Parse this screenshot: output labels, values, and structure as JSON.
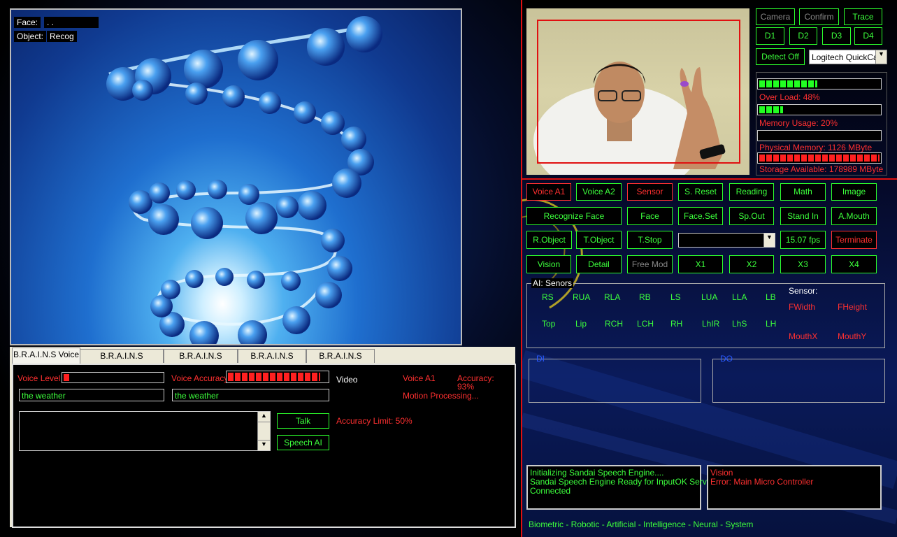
{
  "viewer": {
    "face_label": "Face:",
    "face_value": ".                  .",
    "object_label": "Object:",
    "object_value": "Recog"
  },
  "tabs": [
    {
      "label": "B.R.A.I.N.S Voice"
    },
    {
      "label": "B.R.A.I.N.S Movement"
    },
    {
      "label": "B.R.A.I.N.S Manual"
    },
    {
      "label": "B.R.A.I.N.S Vision"
    },
    {
      "label": "B.R.A.I.N.S Senor"
    }
  ],
  "voice": {
    "level_label": "Voice Level",
    "level_fraction": 0.06,
    "accuracy_label": "Voice Accuracy",
    "accuracy_fraction": 0.93,
    "field1_value": "the weather",
    "field2_value": "the weather",
    "video_label": "Video",
    "voice_a1_label": "Voice A1",
    "accuracy_text": "Accuracy:",
    "accuracy_value": "93%",
    "motion_text": "Motion Processing...",
    "talk_label": "Talk",
    "speech_ai_label": "Speech AI",
    "accuracy_limit": "Accuracy Limit: 50%"
  },
  "camera_controls": {
    "camera_label": "Camera",
    "confirm_label": "Confirm",
    "trace_label": "Trace",
    "d1": "D1",
    "d2": "D2",
    "d3": "D3",
    "d4": "D4",
    "detect_off": "Detect Off",
    "camera_select": "Logitech QuickCam"
  },
  "stats": {
    "overload_label": "Over Load: 48%",
    "overload_fraction": 0.48,
    "memory_label": "Memory Usage: 20%",
    "memory_fraction": 0.2,
    "physical_label": "Physical Memory: 1126 MByte",
    "physical_fraction": 0.0,
    "storage_label": "Storage Available: 178989 MByte",
    "storage_fraction": 1.0
  },
  "buttons": {
    "row1": [
      "Voice A1",
      "Voice A2",
      "Sensor",
      "S. Reset",
      "Reading",
      "Math",
      "Image"
    ],
    "row2": [
      "Recognize Face",
      "Face",
      "Face.Set",
      "Sp.Out",
      "Stand In",
      "A.Mouth"
    ],
    "row3": [
      "R.Object",
      "T.Object",
      "T.Stop",
      "15.07 fps",
      "Terminate"
    ],
    "row4": [
      "Vision",
      "Detail",
      "Free Mod",
      "X1",
      "X2",
      "X3",
      "X4"
    ]
  },
  "sensors": {
    "title": "AI: Senors",
    "row1": [
      "RS",
      "RUA",
      "RLA",
      "RB",
      "LS",
      "LUA",
      "LLA",
      "LB"
    ],
    "row2": [
      "Top",
      "Lip",
      "RCH",
      "LCH",
      "RH",
      "LhIR",
      "LhS",
      "LH"
    ],
    "sensor_label": "Sensor:",
    "fwidth": "FWidth",
    "fheight": "FHeight",
    "mouthx": "MouthX",
    "mouthy": "MouthY"
  },
  "di_label": "DI",
  "do_label": "DO",
  "log_left": [
    "Initializing Sandai Speech Engine....",
    "Sandai Speech Engine Ready for InputOK Server",
    "Connected"
  ],
  "log_right": [
    "Vision",
    " Error: Main Micro Controller"
  ],
  "footer": "Biometric - Robotic - Artificial - Intelligence - Neural - System",
  "colors": {
    "green": "#3cff3c",
    "red": "#ff3030",
    "panel": "#ece9d8"
  }
}
